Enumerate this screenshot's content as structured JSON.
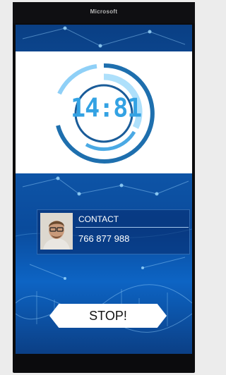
{
  "status_bar": {
    "carrier": "Microsoft"
  },
  "timer": {
    "value": "14:81"
  },
  "contact": {
    "label": "CONTACT",
    "number": "766 877 988"
  },
  "actions": {
    "stop_label": "STOP!"
  },
  "colors": {
    "accent": "#33a2e3",
    "ring_dark": "#1e6fae",
    "ring_light": "#8fd0f7",
    "screen_blue": "#0f57aa"
  },
  "icons": [
    "avatar-photo"
  ]
}
